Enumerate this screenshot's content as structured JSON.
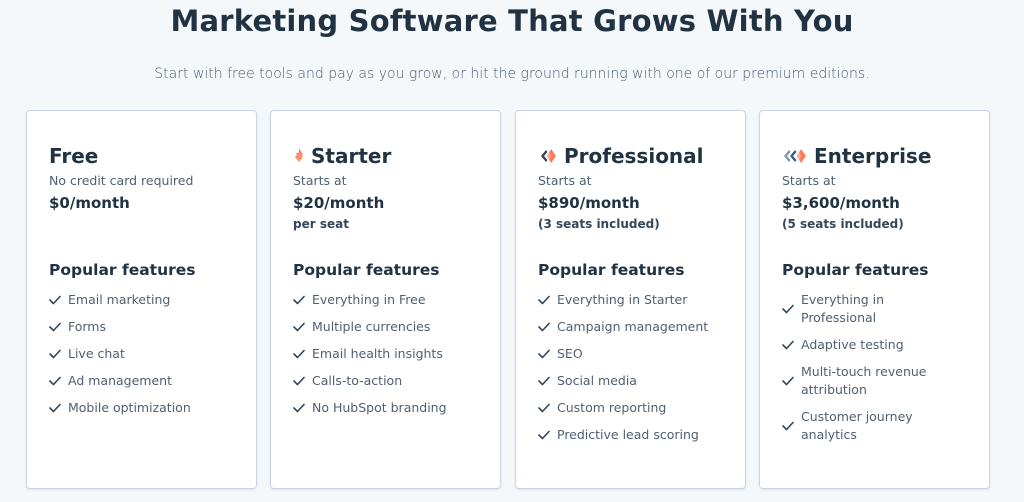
{
  "header": {
    "title": "Marketing Software That Grows With You",
    "subtitle": "Start with free tools and pay as you grow, or hit the ground running with one of our premium editions."
  },
  "colors": {
    "background": "#f5f8fa",
    "heading": "#213343",
    "body_text": "#4f5f70",
    "accent_orange": "#ff7a59",
    "accent_navy": "#425b76",
    "card_border": "#cbd6e2"
  },
  "plans": [
    {
      "name": "Free",
      "icon": "none",
      "note": "No credit card required",
      "price": "$0/month",
      "price_sub": "",
      "features_heading": "Popular features",
      "features": [
        "Email marketing",
        "Forms",
        "Live chat",
        "Ad management",
        "Mobile optimization"
      ]
    },
    {
      "name": "Starter",
      "icon": "starter-sprocket-icon",
      "note": "Starts at",
      "price": "$20/month",
      "price_sub": "per seat",
      "features_heading": "Popular features",
      "features": [
        "Everything in Free",
        "Multiple currencies",
        "Email health insights",
        "Calls-to-action",
        "No HubSpot branding"
      ]
    },
    {
      "name": "Professional",
      "icon": "professional-sprocket-icon",
      "note": "Starts at",
      "price": "$890/month",
      "price_sub": "(3 seats included)",
      "features_heading": "Popular features",
      "features": [
        "Everything in Starter",
        "Campaign management",
        "SEO",
        "Social media",
        "Custom reporting",
        "Predictive lead scoring"
      ]
    },
    {
      "name": "Enterprise",
      "icon": "enterprise-sprocket-icon",
      "note": "Starts at",
      "price": "$3,600/month",
      "price_sub": "(5 seats included)",
      "features_heading": "Popular features",
      "features": [
        "Everything in Professional",
        "Adaptive testing",
        "Multi-touch revenue attribution",
        "Customer journey analytics"
      ]
    }
  ]
}
